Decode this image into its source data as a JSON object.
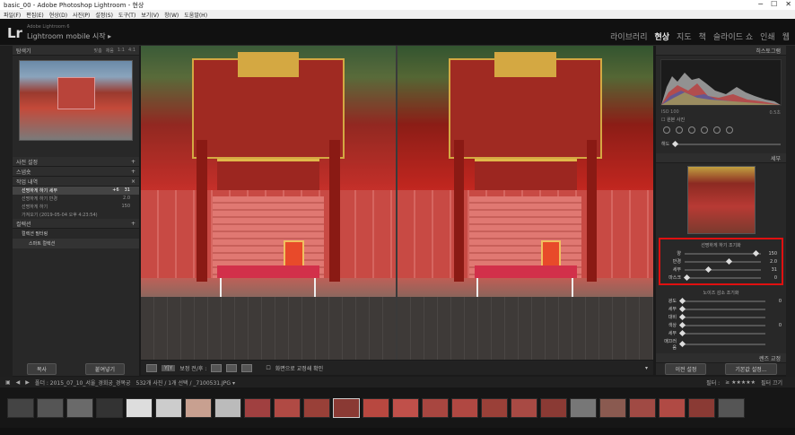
{
  "window": {
    "title": "basic_00 - Adobe Photoshop Lightroom - 현상"
  },
  "menu": [
    "파일(F)",
    "편집(E)",
    "현상(D)",
    "사진(P)",
    "설정(S)",
    "도구(T)",
    "보기(V)",
    "창(W)",
    "도움말(H)"
  ],
  "identity": {
    "logo": "Lr",
    "product": "Adobe Lightroom 6",
    "mobile": "Lightroom mobile 시작 ▸"
  },
  "modules": [
    "라이브러리",
    "현상",
    "지도",
    "책",
    "슬라이드 쇼",
    "인쇄",
    "웹"
  ],
  "left_panel": {
    "navigator": {
      "title": "탐색기",
      "options": [
        "맞춤",
        "채움",
        "1:1",
        "4:1"
      ]
    },
    "presets": {
      "title": "사전 설정"
    },
    "snapshots": {
      "title": "스냅숏"
    },
    "history": {
      "title": "작업 내역",
      "items": [
        {
          "label": "선명하게 하기 세부",
          "a": "+6",
          "b": "31"
        },
        {
          "label": "선명하게 하기 반경",
          "a": "",
          "b": "2.0"
        },
        {
          "label": "선명하게 하기",
          "a": "",
          "b": "150"
        },
        {
          "label": "가져오기 (2019-05-04 오후 4:23:54)",
          "a": "",
          "b": ""
        }
      ]
    },
    "collections": {
      "title": "컬렉션",
      "filter": "컬렉션 필터링",
      "smart": "스마트 컬렉션"
    },
    "buttons": {
      "copy": "복사",
      "paste": "붙여넣기"
    }
  },
  "toolbar": {
    "compare_label": "보정 전/후 :",
    "softproof": "화면으로 교정쇄 확인",
    "view_mode": "Y|Y"
  },
  "right_panel": {
    "histogram": {
      "title": "히스토그램",
      "iso": "ISO 100",
      "focal": "",
      "aperture": "",
      "exposure": "0.5초"
    },
    "original": "원본 사진",
    "tone_label": "해도",
    "detail": {
      "title": "세부",
      "sharpening": {
        "title": "선명하게 하기 조기화",
        "rows": [
          {
            "label": "양",
            "value": "150",
            "pos": 0.99
          },
          {
            "label": "반경",
            "value": "2.0",
            "pos": 0.6
          },
          {
            "label": "세부",
            "value": "31",
            "pos": 0.31
          },
          {
            "label": "마스크",
            "value": "0",
            "pos": 0.0
          }
        ]
      },
      "noise": {
        "title": "노이즈 감소 조기화",
        "rows": [
          {
            "label": "광도",
            "value": "0"
          },
          {
            "label": "세부",
            "value": ""
          },
          {
            "label": "대비",
            "value": ""
          },
          {
            "label": "색상",
            "value": "0"
          },
          {
            "label": "세부",
            "value": ""
          },
          {
            "label": "매끄러움",
            "value": ""
          }
        ]
      }
    },
    "lens": {
      "title": "렌즈 교정"
    },
    "buttons": {
      "previous": "이전 설정",
      "reset": "기본값 설정..."
    }
  },
  "filmbar": {
    "path": "폴더 : 2015_07_10_서울_경회궁_경복궁",
    "count": "532개 사진 / 1개 선택 / _7100531.JPG ▾",
    "filter_label": "필터 :",
    "filter_off": "필터 끄기"
  },
  "filmstrip_count": 25,
  "filmstrip_selected": 11
}
